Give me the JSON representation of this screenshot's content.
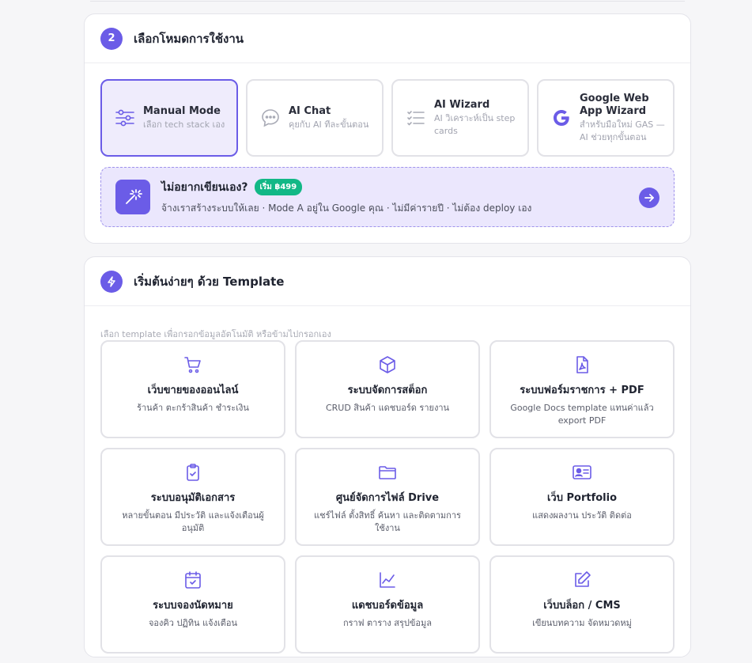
{
  "section_mode": {
    "number": "2",
    "title": "เลือกโหมดการใช้งาน",
    "modes": [
      {
        "title": "Manual Mode",
        "desc": "เลือก tech stack เอง",
        "icon": "sliders-icon"
      },
      {
        "title": "AI Chat",
        "desc": "คุยกับ AI ทีละขั้นตอน",
        "icon": "chat-bubble-icon"
      },
      {
        "title": "AI Wizard",
        "desc": "AI วิเคราะห์เป็น step cards",
        "icon": "checklist-icon"
      },
      {
        "title": "Google Web App Wizard",
        "desc": "สำหรับมือใหม่ GAS — AI ช่วยทุกขั้นตอน",
        "icon": "google-g-icon"
      }
    ],
    "promo": {
      "title": "ไม่อยากเขียนเอง?",
      "badge": "เริ่ม ฿499",
      "desc": "จ้างเราสร้างระบบให้เลย · Mode A อยู่ใน Google คุณ · ไม่มีค่ารายปี · ไม่ต้อง deploy เอง"
    }
  },
  "section_template": {
    "title": "เริ่มต้นง่ายๆ ด้วย Template",
    "hint": "เลือก template เพื่อกรอกข้อมูลอัตโนมัติ หรือข้ามไปกรอกเอง",
    "templates": [
      {
        "title": "เว็บขายของออนไลน์",
        "desc": "ร้านค้า ตะกร้าสินค้า ชำระเงิน",
        "icon": "cart-icon"
      },
      {
        "title": "ระบบจัดการสต็อก",
        "desc": "CRUD สินค้า แดชบอร์ด รายงาน",
        "icon": "box-icon"
      },
      {
        "title": "ระบบฟอร์มราชการ + PDF",
        "desc": "Google Docs template แทนค่าแล้ว export PDF",
        "icon": "pdf-file-icon"
      },
      {
        "title": "ระบบอนุมัติเอกสาร",
        "desc": "หลายขั้นตอน มีประวัติ และแจ้งเตือนผู้อนุมัติ",
        "icon": "clipboard-check-icon"
      },
      {
        "title": "ศูนย์จัดการไฟล์ Drive",
        "desc": "แชร์ไฟล์ ตั้งสิทธิ์ ค้นหา และติดตามการใช้งาน",
        "icon": "folder-icon"
      },
      {
        "title": "เว็บ Portfolio",
        "desc": "แสดงผลงาน ประวัติ ติดต่อ",
        "icon": "id-card-icon"
      },
      {
        "title": "ระบบจองนัดหมาย",
        "desc": "จองคิว ปฏิทิน แจ้งเตือน",
        "icon": "calendar-check-icon"
      },
      {
        "title": "แดชบอร์ดข้อมูล",
        "desc": "กราฟ ตาราง สรุปข้อมูล",
        "icon": "line-chart-icon"
      },
      {
        "title": "เว็บบล็อก / CMS",
        "desc": "เขียนบทความ จัดหมวดหมู่",
        "icon": "edit-icon"
      }
    ]
  },
  "colors": {
    "accent": "#6b5ce7",
    "badge": "#12b886",
    "promo_bg": "#ebe7fd"
  }
}
